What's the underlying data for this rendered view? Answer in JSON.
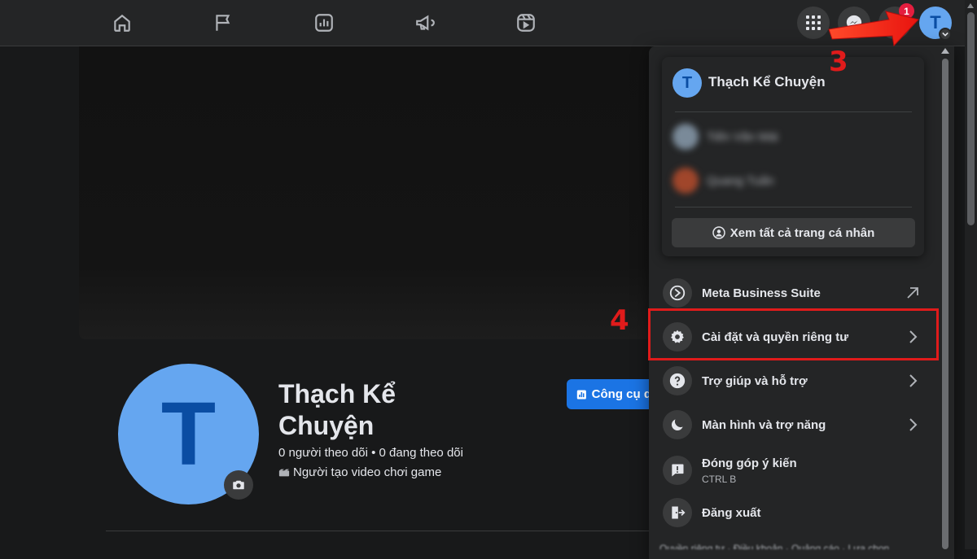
{
  "topbar": {
    "nav_icons": [
      "home-icon",
      "flag-icon",
      "insights-icon",
      "megaphone-icon",
      "reels-icon"
    ],
    "notification_count": "1",
    "user_initial": "T"
  },
  "profile": {
    "initial": "T",
    "name": "Thạch Kể Chuyện",
    "stats": "0 người theo dõi • 0 đang theo dõi",
    "category": "Người tạo video chơi game",
    "tools_button": "Công cụ q"
  },
  "account_menu": {
    "current_user": {
      "initial": "T",
      "name": "Thạch Kể Chuyện"
    },
    "other_profiles": [
      {
        "name": "Tiến Văn Mái",
        "avatar_color": "#7a8a99"
      },
      {
        "name": "Quang Tuấn",
        "avatar_color": "#a0462b"
      }
    ],
    "see_all_label": "Xem tất cả trang cá nhân",
    "items": [
      {
        "label": "Meta Business Suite",
        "icon": "meta-business-icon",
        "trailing": "external-arrow"
      },
      {
        "label": "Cài đặt và quyền riêng tư",
        "icon": "gear-icon",
        "trailing": "chevron"
      },
      {
        "label": "Trợ giúp và hỗ trợ",
        "icon": "help-icon",
        "trailing": "chevron"
      },
      {
        "label": "Màn hình và trợ năng",
        "icon": "moon-icon",
        "trailing": "chevron"
      },
      {
        "label": "Đóng góp ý kiến",
        "sub": "CTRL B",
        "icon": "feedback-icon",
        "trailing": ""
      },
      {
        "label": "Đăng xuất",
        "icon": "logout-icon",
        "trailing": ""
      }
    ],
    "footer_peek": "Quyền riêng tư · Điều khoản · Quảng cáo · Lựa chọn"
  },
  "annotations": {
    "step3": "3",
    "step4": "4",
    "accent_color": "#e01b1b"
  }
}
